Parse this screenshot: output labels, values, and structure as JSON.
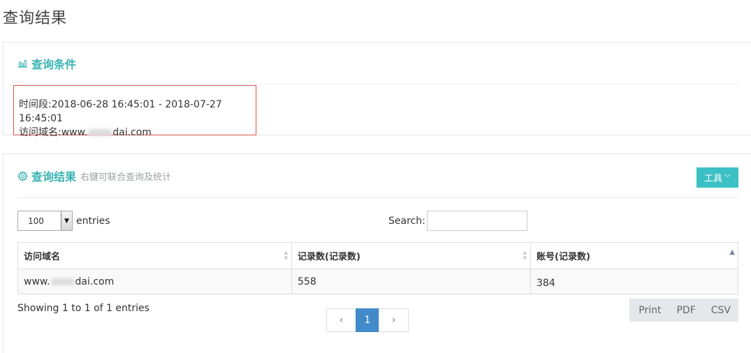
{
  "page": {
    "title": "查询结果"
  },
  "conditions_panel": {
    "icon": "bar-chart-icon",
    "title": "查询条件",
    "time_range": "时间段:2018-06-28 16:45:01 - 2018-07-27 16:45:01",
    "domain_prefix": "访问域名:www.",
    "domain_suffix": "dai.com"
  },
  "results_panel": {
    "icon": "gear-icon",
    "title": "查询结果",
    "subtitle": "右键可联合查询及统计",
    "tools_button": "工具",
    "length": {
      "selected": "100",
      "label": "entries"
    },
    "search": {
      "label": "Search:",
      "value": "",
      "placeholder": ""
    },
    "table": {
      "headers": [
        "访问域名",
        "记录数(记录数)",
        "账号(记录数)"
      ],
      "rows": [
        {
          "domain_prefix": "www.",
          "domain_suffix": "dai.com",
          "records": "558",
          "accounts": "384"
        }
      ]
    },
    "info": "Showing 1 to 1 of 1 entries",
    "pagination": {
      "prev": "‹",
      "current": "1",
      "next": "›"
    },
    "export_buttons": [
      "Print",
      "PDF",
      "CSV"
    ]
  },
  "colors": {
    "accent": "#39b3b3",
    "tool_button": "#3dc0c5",
    "pager_active": "#428bca",
    "highlight_border": "#d9534f"
  }
}
